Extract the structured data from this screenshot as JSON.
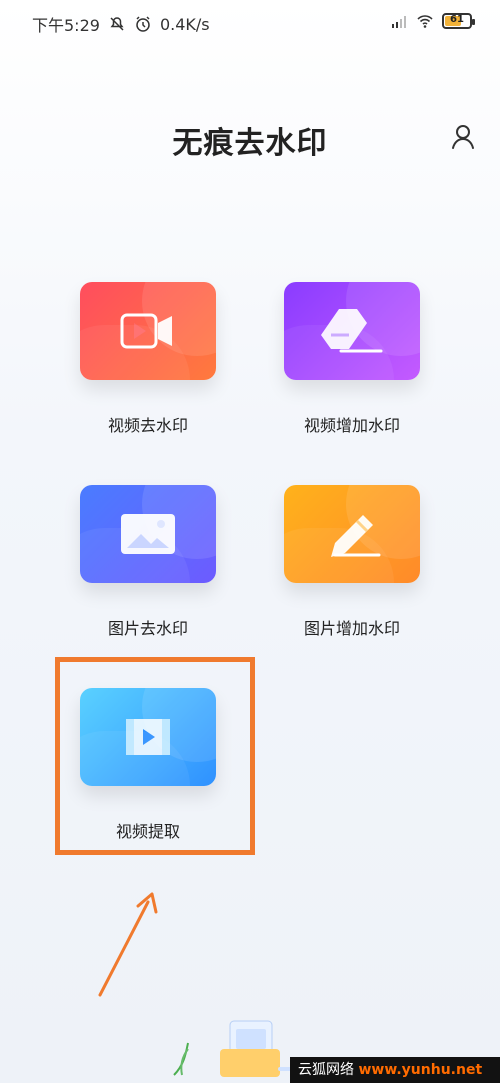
{
  "status_bar": {
    "time": "下午5:29",
    "speed": "0.4K/s",
    "battery": "61",
    "icons": [
      "mute-icon",
      "alarm-icon",
      "signal-icon",
      "wifi-icon",
      "battery-icon"
    ]
  },
  "header": {
    "title": "无痕去水印",
    "profile_icon": "user-icon"
  },
  "features": [
    {
      "label": "视频去水印",
      "icon": "video-camera-icon",
      "color": "#ff4d5e"
    },
    {
      "label": "视频增加水印",
      "icon": "eraser-icon",
      "color": "#8a3cff"
    },
    {
      "label": "图片去水印",
      "icon": "image-icon",
      "color": "#4a7cff"
    },
    {
      "label": "图片增加水印",
      "icon": "pencil-icon",
      "color": "#ffb21b"
    },
    {
      "label": "视频提取",
      "icon": "video-extract-icon",
      "color": "#2f91ff"
    }
  ],
  "annotation": {
    "highlight_color": "#f07a2e"
  },
  "watermark": {
    "text": "云狐网络",
    "url": "www.yunhu.net"
  }
}
